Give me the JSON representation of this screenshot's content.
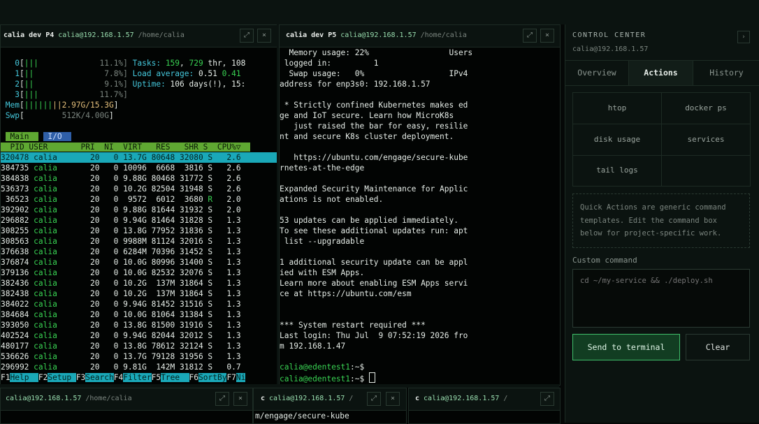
{
  "pane1": {
    "title": "calia dev P4",
    "host": "calia@192.168.1.57",
    "path": "/home/calia",
    "expand_icon": "⤢",
    "close_icon": "×",
    "cpus": [
      {
        "n": "0",
        "bar": "|||",
        "val": "11.1%]"
      },
      {
        "n": "1",
        "bar": "||",
        "val": "7.8%]"
      },
      {
        "n": "2",
        "bar": "||",
        "val": "9.1%]"
      },
      {
        "n": "3",
        "bar": "|||",
        "val": "11.7%]"
      }
    ],
    "mem": {
      "label": "Mem",
      "bar": "||||||||",
      "val": "2.97G/15.3G"
    },
    "swp": {
      "label": "Swp",
      "bar": "",
      "val": "512K/4.00G"
    },
    "tasks": {
      "label": "Tasks:",
      "a": "159",
      "b": "729",
      "c": "thr, 108"
    },
    "load": {
      "label": "Load average:",
      "a": "0.51",
      "b": "0.41"
    },
    "uptime": {
      "label": "Uptime:",
      "a": "106 days(!), 15:"
    },
    "tab_main": "Main",
    "tab_io": "I/O",
    "header": "  PID USER       PRI  NI  VIRT   RES   SHR S  CPU%▽",
    "processes": [
      [
        "320478",
        "calia",
        "20",
        "0",
        "13.7G",
        "80648",
        "32080",
        "S",
        "2.6"
      ],
      [
        "384735",
        "calia",
        "20",
        "0",
        "10096",
        "6668",
        "3816",
        "S",
        "2.6"
      ],
      [
        "384838",
        "calia",
        "20",
        "0",
        "9.88G",
        "80468",
        "31772",
        "S",
        "2.6"
      ],
      [
        "536373",
        "calia",
        "20",
        "0",
        "10.2G",
        "82504",
        "31948",
        "S",
        "2.6"
      ],
      [
        "36523",
        "calia",
        "20",
        "0",
        "9572",
        "6012",
        "3680",
        "R",
        "2.0"
      ],
      [
        "392902",
        "calia",
        "20",
        "0",
        "9.88G",
        "81644",
        "31932",
        "S",
        "2.0"
      ],
      [
        "296882",
        "calia",
        "20",
        "0",
        "9.94G",
        "81464",
        "31828",
        "S",
        "1.3"
      ],
      [
        "308255",
        "calia",
        "20",
        "0",
        "13.8G",
        "77952",
        "31836",
        "S",
        "1.3"
      ],
      [
        "308563",
        "calia",
        "20",
        "0",
        "9988M",
        "81124",
        "32016",
        "S",
        "1.3"
      ],
      [
        "376638",
        "calia",
        "20",
        "0",
        "6284M",
        "70396",
        "31452",
        "S",
        "1.3"
      ],
      [
        "376874",
        "calia",
        "20",
        "0",
        "10.0G",
        "80996",
        "31400",
        "S",
        "1.3"
      ],
      [
        "379136",
        "calia",
        "20",
        "0",
        "10.0G",
        "82532",
        "32076",
        "S",
        "1.3"
      ],
      [
        "382436",
        "calia",
        "20",
        "0",
        "10.2G",
        "137M",
        "31864",
        "S",
        "1.3"
      ],
      [
        "382438",
        "calia",
        "20",
        "0",
        "10.2G",
        "137M",
        "31864",
        "S",
        "1.3"
      ],
      [
        "384022",
        "calia",
        "20",
        "0",
        "9.94G",
        "81452",
        "31516",
        "S",
        "1.3"
      ],
      [
        "384684",
        "calia",
        "20",
        "0",
        "10.0G",
        "81064",
        "31384",
        "S",
        "1.3"
      ],
      [
        "393050",
        "calia",
        "20",
        "0",
        "13.8G",
        "81500",
        "31916",
        "S",
        "1.3"
      ],
      [
        "402524",
        "calia",
        "20",
        "0",
        "9.94G",
        "82044",
        "32012",
        "S",
        "1.3"
      ],
      [
        "480177",
        "calia",
        "20",
        "0",
        "13.8G",
        "78612",
        "32124",
        "S",
        "1.3"
      ],
      [
        "536626",
        "calia",
        "20",
        "0",
        "13.7G",
        "79128",
        "31956",
        "S",
        "1.3"
      ],
      [
        "296992",
        "calia",
        "20",
        "0",
        "9.81G",
        "142M",
        "31812",
        "S",
        "0.7"
      ]
    ],
    "fkeys": [
      {
        "k": "F1",
        "v": "Help  "
      },
      {
        "k": "F2",
        "v": "Setup "
      },
      {
        "k": "F3",
        "v": "Search"
      },
      {
        "k": "F4",
        "v": "Filter"
      },
      {
        "k": "F5",
        "v": "Tree  "
      },
      {
        "k": "F6",
        "v": "SortBy"
      },
      {
        "k": "F7",
        "v": "Ni"
      }
    ]
  },
  "pane2": {
    "title": "calia dev P5",
    "host": "calia@192.168.1.57",
    "path": "/home/calia",
    "expand_icon": "⤢",
    "close_icon": "×",
    "lines": [
      "  Memory usage: 22%                 Users",
      " logged in:         1",
      "  Swap usage:   0%                  IPv4",
      "address for enp3s0: 192.168.1.57",
      "",
      " * Strictly confined Kubernetes makes ed",
      "ge and IoT secure. Learn how MicroK8s",
      "   just raised the bar for easy, resilie",
      "nt and secure K8s cluster deployment.",
      "",
      "   https://ubuntu.com/engage/secure-kube",
      "rnetes-at-the-edge",
      "",
      "Expanded Security Maintenance for Applic",
      "ations is not enabled.",
      "",
      "53 updates can be applied immediately.",
      "To see these additional updates run: apt",
      " list --upgradable",
      "",
      "1 additional security update can be appl",
      "ied with ESM Apps.",
      "Learn more about enabling ESM Apps servi",
      "ce at https://ubuntu.com/esm",
      "",
      "",
      "*** System restart required ***",
      "Last login: Thu Jul  9 07:52:19 2026 fro",
      "m 192.168.1.47",
      ""
    ],
    "prompt_user": "calia@edentest1",
    "prompt_suffix": ":~$"
  },
  "pane3": {
    "host": "calia@192.168.1.57",
    "path": "/home/calia",
    "expand_icon": "⤢",
    "close_icon": "×"
  },
  "pane4": {
    "title": "c",
    "host": "calia@192.168.1.57",
    "path": "/",
    "expand_icon": "⤢",
    "close_icon": "×",
    "line": "m/engage/secure-kube"
  },
  "pane5": {
    "title": "c",
    "host": "calia@192.168.1.57",
    "path": "/",
    "expand_icon": "⤢"
  },
  "control_center": {
    "title": "CONTROL CENTER",
    "host": "calia@192.168.1.57",
    "collapse_icon": "›",
    "tabs": [
      "Overview",
      "Actions",
      "History"
    ],
    "active_tab": "Actions",
    "actions": [
      "htop",
      "docker ps",
      "disk usage",
      "services",
      "tail logs"
    ],
    "note": "Quick Actions are generic command templates. Edit the command box below for project-specific work.",
    "custom_label": "Custom command",
    "custom_placeholder": "cd ~/my-service && ./deploy.sh",
    "send_label": "Send to terminal",
    "clear_label": "Clear"
  }
}
